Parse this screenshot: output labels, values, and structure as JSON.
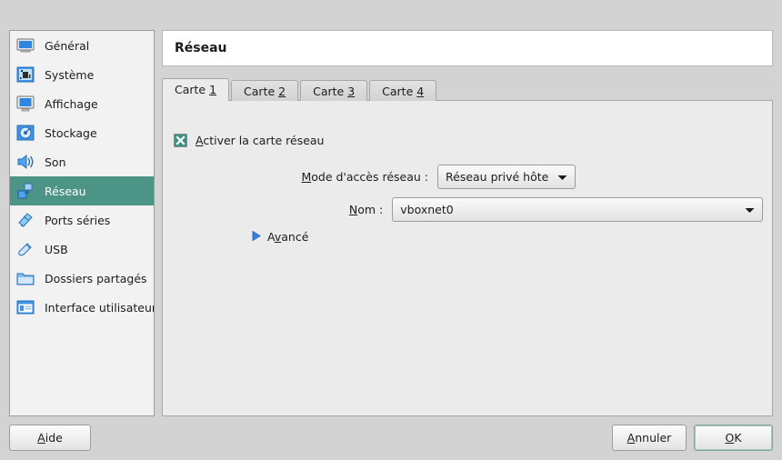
{
  "window": {
    "background_color": "#d3d3d3"
  },
  "sidebar": {
    "selected_index": 5,
    "items": [
      {
        "label": "Général",
        "icon": "monitor-icon",
        "selected": false
      },
      {
        "label": "Système",
        "icon": "motherboard-icon",
        "selected": false
      },
      {
        "label": "Affichage",
        "icon": "display-icon",
        "selected": false
      },
      {
        "label": "Stockage",
        "icon": "disk-icon",
        "selected": false
      },
      {
        "label": "Son",
        "icon": "speaker-icon",
        "selected": false
      },
      {
        "label": "Réseau",
        "icon": "network-icon",
        "selected": true
      },
      {
        "label": "Ports séries",
        "icon": "serial-port-icon",
        "selected": false
      },
      {
        "label": "USB",
        "icon": "usb-icon",
        "selected": false
      },
      {
        "label": "Dossiers partagés",
        "icon": "folder-icon",
        "selected": false
      },
      {
        "label": "Interface utilisateur",
        "icon": "user-interface-icon",
        "selected": false
      }
    ]
  },
  "header": {
    "title": "Réseau"
  },
  "tabs": {
    "active_index": 0,
    "items": [
      {
        "prefix": "Carte ",
        "mnemonic": "1"
      },
      {
        "prefix": "Carte ",
        "mnemonic": "2"
      },
      {
        "prefix": "Carte ",
        "mnemonic": "3"
      },
      {
        "prefix": "Carte ",
        "mnemonic": "4"
      }
    ]
  },
  "form": {
    "enable_adapter": {
      "mnemonic": "A",
      "label_rest": "ctiver la carte réseau",
      "checked": true,
      "check_color": "#3f9182"
    },
    "attached_to": {
      "label_mnemonic": "M",
      "label_rest": "ode d'accès réseau :",
      "value": "Réseau privé hôte"
    },
    "name": {
      "label_mnemonic": "N",
      "label_rest": "om :",
      "value": "vboxnet0"
    },
    "advanced": {
      "mnemonic": "v",
      "label_before": "A",
      "label_after": "ancé",
      "expanded": false,
      "arrow_color": "#2a6fc4"
    }
  },
  "footer": {
    "help": {
      "mnemonic": "A",
      "rest": "ide"
    },
    "cancel": {
      "mnemonic": "A",
      "rest": "nnuler"
    },
    "ok": {
      "mnemonic": "O",
      "rest": "K"
    }
  }
}
